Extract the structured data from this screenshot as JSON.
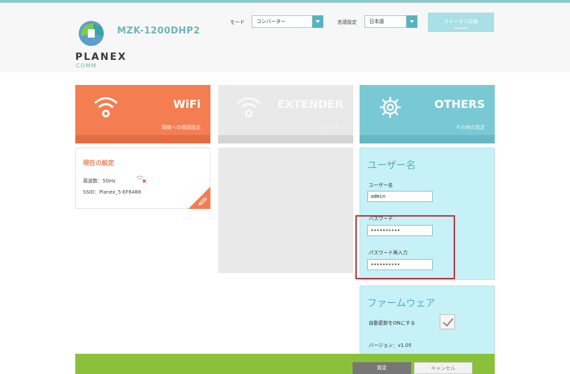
{
  "header": {
    "model": "MZK-1200DHP2",
    "brand": "PLANEX",
    "brand_sub": "COMM.",
    "mode_label": "モード",
    "mode_value": "コンバーター",
    "lang_label": "言語設定",
    "lang_value": "日本語",
    "status_button": "ステータス詳細"
  },
  "tiles": {
    "wifi": {
      "title": "WiFi",
      "subtitle": "親機への接続設定"
    },
    "extender": {
      "title": "EXTENDER",
      "subtitle": "リピーター"
    },
    "others": {
      "title": "OTHERS",
      "subtitle": "その他の設定"
    }
  },
  "current": {
    "heading": "現在の設定",
    "frequency": "周波数：5GHz",
    "ssid": "SSID：Planex_5-EF6488"
  },
  "user": {
    "title": "ユーザー名",
    "username_label": "ユーザー名",
    "username_value": "admin",
    "password_label": "パスワード",
    "password_value": "••••••••••",
    "password_confirm_label": "パスワード再入力",
    "password_confirm_value": "••••••••••"
  },
  "firmware": {
    "title": "ファームウェア",
    "auto_update_label": "自動更新をONにする",
    "version": "バージョン：v1.05"
  },
  "footer": {
    "apply": "設定",
    "cancel": "キャンセル"
  },
  "colors": {
    "wifi": "#f47e52",
    "others": "#78c9d4",
    "footer": "#8bc03a",
    "highlight": "#c0303a"
  }
}
